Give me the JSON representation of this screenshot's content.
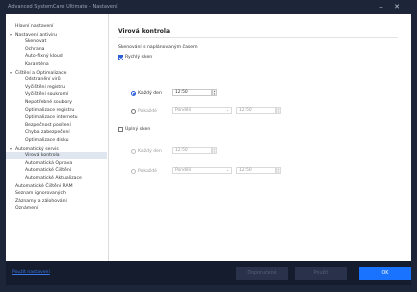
{
  "window": {
    "title": "Advanced SystemCare Ultimate - Nastavení"
  },
  "sidebar": {
    "items": [
      {
        "label": "Hlavní nastavení",
        "indent": 0,
        "arrow": "",
        "selected": false
      },
      {
        "label": "Nastavení antiviru",
        "indent": 0,
        "arrow": "▾",
        "selected": false
      },
      {
        "label": "Skenovat",
        "indent": 2,
        "arrow": "",
        "selected": false
      },
      {
        "label": "Ochrana",
        "indent": 2,
        "arrow": "",
        "selected": false
      },
      {
        "label": "Auto-fixný kloud",
        "indent": 2,
        "arrow": "",
        "selected": false
      },
      {
        "label": "Karanténa",
        "indent": 2,
        "arrow": "",
        "selected": false
      },
      {
        "label": "Čištění a Optimalizace",
        "indent": 0,
        "arrow": "▾",
        "selected": false
      },
      {
        "label": "Odstranění virů",
        "indent": 2,
        "arrow": "",
        "selected": false
      },
      {
        "label": "Vyčištění registru",
        "indent": 2,
        "arrow": "",
        "selected": false
      },
      {
        "label": "Vyčištění soukromí",
        "indent": 2,
        "arrow": "",
        "selected": false
      },
      {
        "label": "Nepotřebné soubory",
        "indent": 2,
        "arrow": "",
        "selected": false
      },
      {
        "label": "Optimalizace registru",
        "indent": 2,
        "arrow": "",
        "selected": false
      },
      {
        "label": "Optimalizace internetu",
        "indent": 2,
        "arrow": "",
        "selected": false
      },
      {
        "label": "Bezpečnost posílení",
        "indent": 2,
        "arrow": "",
        "selected": false
      },
      {
        "label": "Chyba zabezpečení",
        "indent": 2,
        "arrow": "",
        "selected": false
      },
      {
        "label": "Optimalizace disku",
        "indent": 2,
        "arrow": "",
        "selected": false
      },
      {
        "label": "Automatický servis",
        "indent": 0,
        "arrow": "▾",
        "selected": false
      },
      {
        "label": "Virová kontrola",
        "indent": 2,
        "arrow": "",
        "selected": true
      },
      {
        "label": "Automatická Oprava",
        "indent": 2,
        "arrow": "",
        "selected": false
      },
      {
        "label": "Automatické Čištění",
        "indent": 2,
        "arrow": "",
        "selected": false
      },
      {
        "label": "Automatické Aktualizace",
        "indent": 2,
        "arrow": "",
        "selected": false
      },
      {
        "label": "Automatické Čištění RAM",
        "indent": 0,
        "arrow": "",
        "selected": false
      },
      {
        "label": "Seznam ignorovaných",
        "indent": 0,
        "arrow": "",
        "selected": false
      },
      {
        "label": "Záznamy a zálohování",
        "indent": 0,
        "arrow": "",
        "selected": false
      },
      {
        "label": "Oznámení",
        "indent": 0,
        "arrow": "",
        "selected": false
      }
    ]
  },
  "main": {
    "heading": "Virová kontrola",
    "schedule_label": "Skenování s naplánovaným časem",
    "quick_scan": {
      "label": "Rychlý sken",
      "checked": true,
      "daily_label": "Každý den",
      "daily_time": "12:50",
      "weekly_label": "Pokaždé",
      "weekly_day": "Pondělí",
      "weekly_time": "12:50"
    },
    "full_scan": {
      "label": "Úplný sken",
      "checked": false,
      "daily_label": "Každý den",
      "daily_time": "12:50",
      "weekly_label": "Pokaždé",
      "weekly_day": "Pondělí",
      "weekly_time": "12:50"
    }
  },
  "footer": {
    "link": "Použít nastavení",
    "recommended_label": "Doporučené",
    "apply_label": "Použít",
    "ok_label": "OK"
  },
  "colors": {
    "window_bg": "#1d2538",
    "footer_bg": "#141c2e",
    "accent": "#1a73ff",
    "selection": "#dfe6f0"
  }
}
